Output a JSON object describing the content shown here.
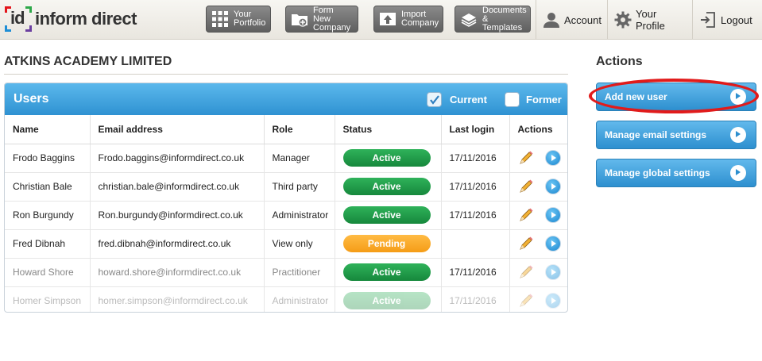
{
  "logo": {
    "mark": "id",
    "word": "inform direct"
  },
  "nav": [
    {
      "label": "Your\nPortfolio",
      "icon": "grid-icon"
    },
    {
      "label": "Form New\nCompany",
      "icon": "folder-plus-icon"
    },
    {
      "label": "Import\nCompany",
      "icon": "upload-icon"
    },
    {
      "label": "Documents\n& Templates",
      "icon": "documents-icon"
    }
  ],
  "account": {
    "account_label": "Account",
    "profile_label": "Your Profile",
    "logout_label": "Logout"
  },
  "company_name": "ATKINS ACADEMY LIMITED",
  "users_panel": {
    "title": "Users",
    "filters": [
      {
        "label": "Current",
        "checked": true
      },
      {
        "label": "Former",
        "checked": false
      }
    ],
    "columns": [
      "Name",
      "Email address",
      "Role",
      "Status",
      "Last login",
      "Actions"
    ],
    "rows": [
      {
        "name": "Frodo Baggins",
        "email": "Frodo.baggins@informdirect.co.uk",
        "role": "Manager",
        "status": "Active",
        "last_login": "17/11/2016"
      },
      {
        "name": "Christian Bale",
        "email": "christian.bale@informdirect.co.uk",
        "role": "Third party",
        "status": "Active",
        "last_login": "17/11/2016"
      },
      {
        "name": "Ron Burgundy",
        "email": "Ron.burgundy@informdirect.co.uk",
        "role": "Administrator",
        "status": "Active",
        "last_login": "17/11/2016"
      },
      {
        "name": "Fred Dibnah",
        "email": "fred.dibnah@informdirect.co.uk",
        "role": "View only",
        "status": "Pending",
        "last_login": ""
      },
      {
        "name": "Howard Shore",
        "email": "howard.shore@informdirect.co.uk",
        "role": "Practitioner",
        "status": "Active",
        "last_login": "17/11/2016"
      },
      {
        "name": "Homer Simpson",
        "email": "homer.simpson@informdirect.co.uk",
        "role": "Administrator",
        "status": "Active",
        "last_login": "17/11/2016"
      }
    ]
  },
  "actions": {
    "title": "Actions",
    "buttons": [
      {
        "label": "Add new user"
      },
      {
        "label": "Manage email settings"
      },
      {
        "label": "Manage global settings"
      }
    ]
  },
  "colors": {
    "accent_blue": "#2f92d2",
    "active_green": "#16883c",
    "pending_orange": "#f59c16",
    "highlight_red": "#e11b1b"
  }
}
